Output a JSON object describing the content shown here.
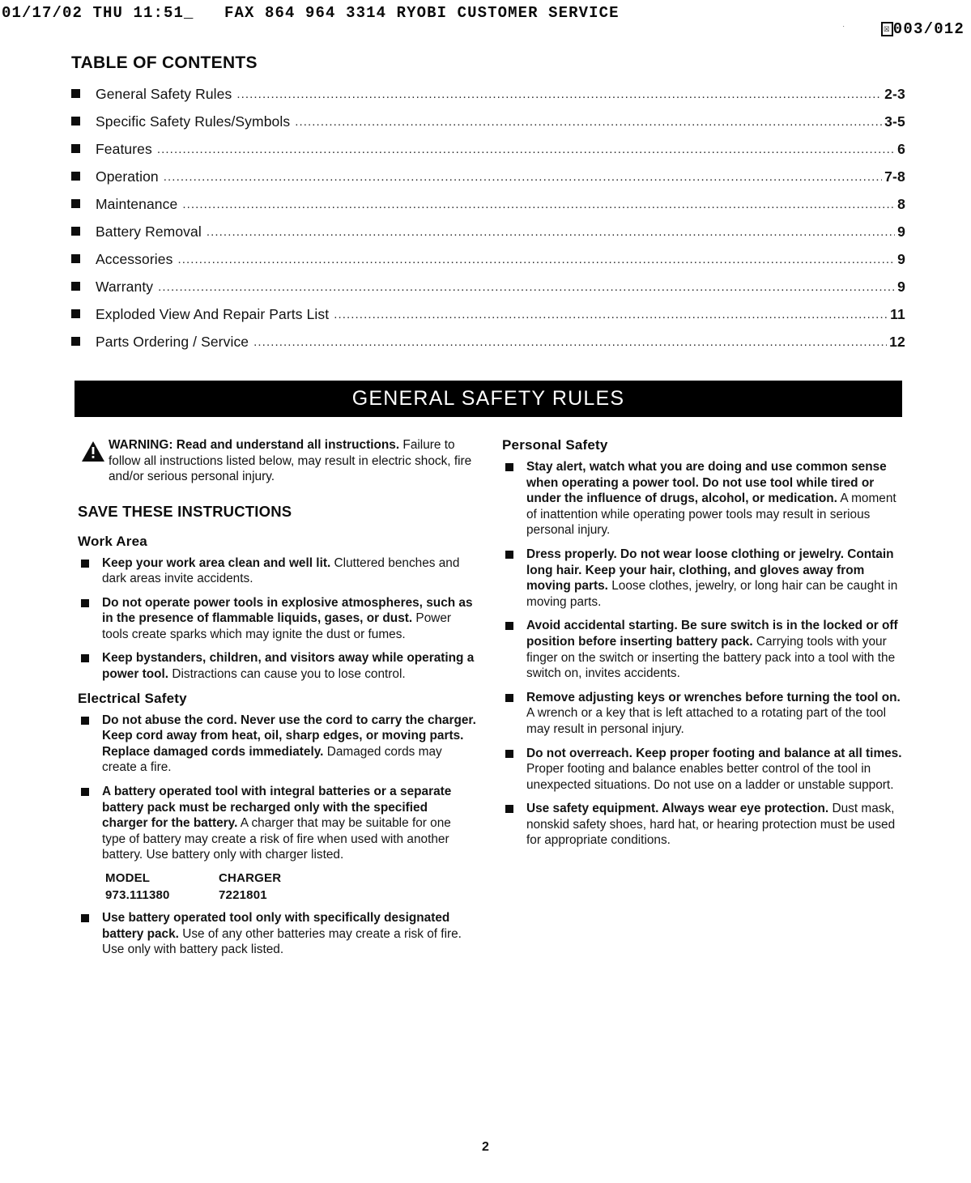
{
  "fax": {
    "header_line": "01/17/02 THU 11:51_   FAX 864 964 3314 RYOBI CUSTOMER SERVICE",
    "page_counter": "003/012",
    "glyph_icon": "fax-document-icon"
  },
  "toc": {
    "title": "TABLE OF CONTENTS",
    "dots": "..........................................................................................................................................................................................................................",
    "items": [
      {
        "label": "General Safety Rules",
        "page": "2-3"
      },
      {
        "label": "Specific Safety Rules/Symbols",
        "page": "3-5"
      },
      {
        "label": "Features",
        "page": "6"
      },
      {
        "label": "Operation",
        "page": "7-8"
      },
      {
        "label": "Maintenance",
        "page": "8"
      },
      {
        "label": "Battery Removal",
        "page": "9"
      },
      {
        "label": "Accessories",
        "page": "9"
      },
      {
        "label": "Warranty",
        "page": "9"
      },
      {
        "label": "Exploded View And Repair Parts List",
        "page": "11"
      },
      {
        "label": "Parts Ordering / Service",
        "page": "12"
      }
    ]
  },
  "banner": {
    "title": "GENERAL SAFETY RULES"
  },
  "warning": {
    "icon": "warning-triangle-icon",
    "bold_lead": "WARNING: Read and understand all instructions.",
    "rest": " Failure to follow all instructions listed below, may result in electric shock, fire and/or serious personal injury."
  },
  "save_instructions_heading": "SAVE THESE INSTRUCTIONS",
  "left_column": {
    "work_area": {
      "heading": "Work Area",
      "bullets": [
        {
          "bold": "Keep your work area clean and well lit.",
          "rest": " Cluttered benches and dark areas invite accidents."
        },
        {
          "bold": "Do not operate power tools in explosive atmospheres, such as in the presence of flammable liquids, gases, or dust.",
          "rest": "  Power tools create sparks which may ignite the dust or fumes."
        },
        {
          "bold": "Keep bystanders, children, and visitors away while operating a power tool.",
          "rest": " Distractions can cause you to lose control."
        }
      ]
    },
    "electrical_safety": {
      "heading": "Electrical Safety",
      "bullets": [
        {
          "bold": "Do not abuse the cord. Never use the cord to carry the charger. Keep cord away from heat, oil, sharp edges, or moving parts. Replace damaged cords immediately.",
          "rest": " Damaged cords may create a fire."
        },
        {
          "bold": "A battery operated tool with integral batteries or a separate battery pack must be recharged only with the specified charger for the battery.",
          "rest": " A charger that may be suitable for one type of battery may create a risk of fire when used with another battery. Use battery only with charger listed."
        }
      ],
      "table": {
        "headers": [
          "MODEL",
          "CHARGER"
        ],
        "rows": [
          [
            "973.111380",
            "7221801"
          ]
        ]
      },
      "last_bullet": {
        "bold": "Use battery operated tool only with specifically designated battery pack.",
        "rest": " Use of any other batteries may create a risk of fire. Use only with battery pack listed."
      }
    }
  },
  "right_column": {
    "personal_safety": {
      "heading": "Personal Safety",
      "bullets": [
        {
          "bold": "Stay alert, watch what you are doing and use common sense when operating a power tool. Do not use tool while tired or under the influence of drugs, alcohol, or medication.",
          "rest": " A moment of inattention while operating power tools may result in serious personal injury."
        },
        {
          "bold": "Dress properly. Do not wear loose clothing or jewelry. Contain long hair. Keep your hair, clothing, and gloves away from moving parts.",
          "rest": " Loose clothes, jewelry, or long hair can be caught in moving parts."
        },
        {
          "bold": "Avoid accidental starting. Be sure switch is in the locked or off position before inserting battery pack.",
          "rest": " Carrying tools with your finger on the switch or inserting the battery pack into a tool with the switch on, invites accidents."
        },
        {
          "bold": "Remove adjusting keys or wrenches before turning the tool on.",
          "rest": " A wrench or a key that is left attached to a rotating part of the tool may result in personal injury."
        },
        {
          "bold": "Do not overreach. Keep proper footing and balance at all times.",
          "rest": " Proper footing and balance enables better control of the tool in unexpected situations. Do not use on a ladder or unstable support."
        },
        {
          "bold": "Use safety equipment. Always wear eye protection.",
          "rest": " Dust mask, nonskid safety shoes, hard hat, or hearing protection must be used for appropriate conditions."
        }
      ]
    }
  },
  "footer": {
    "page_number": "2"
  }
}
